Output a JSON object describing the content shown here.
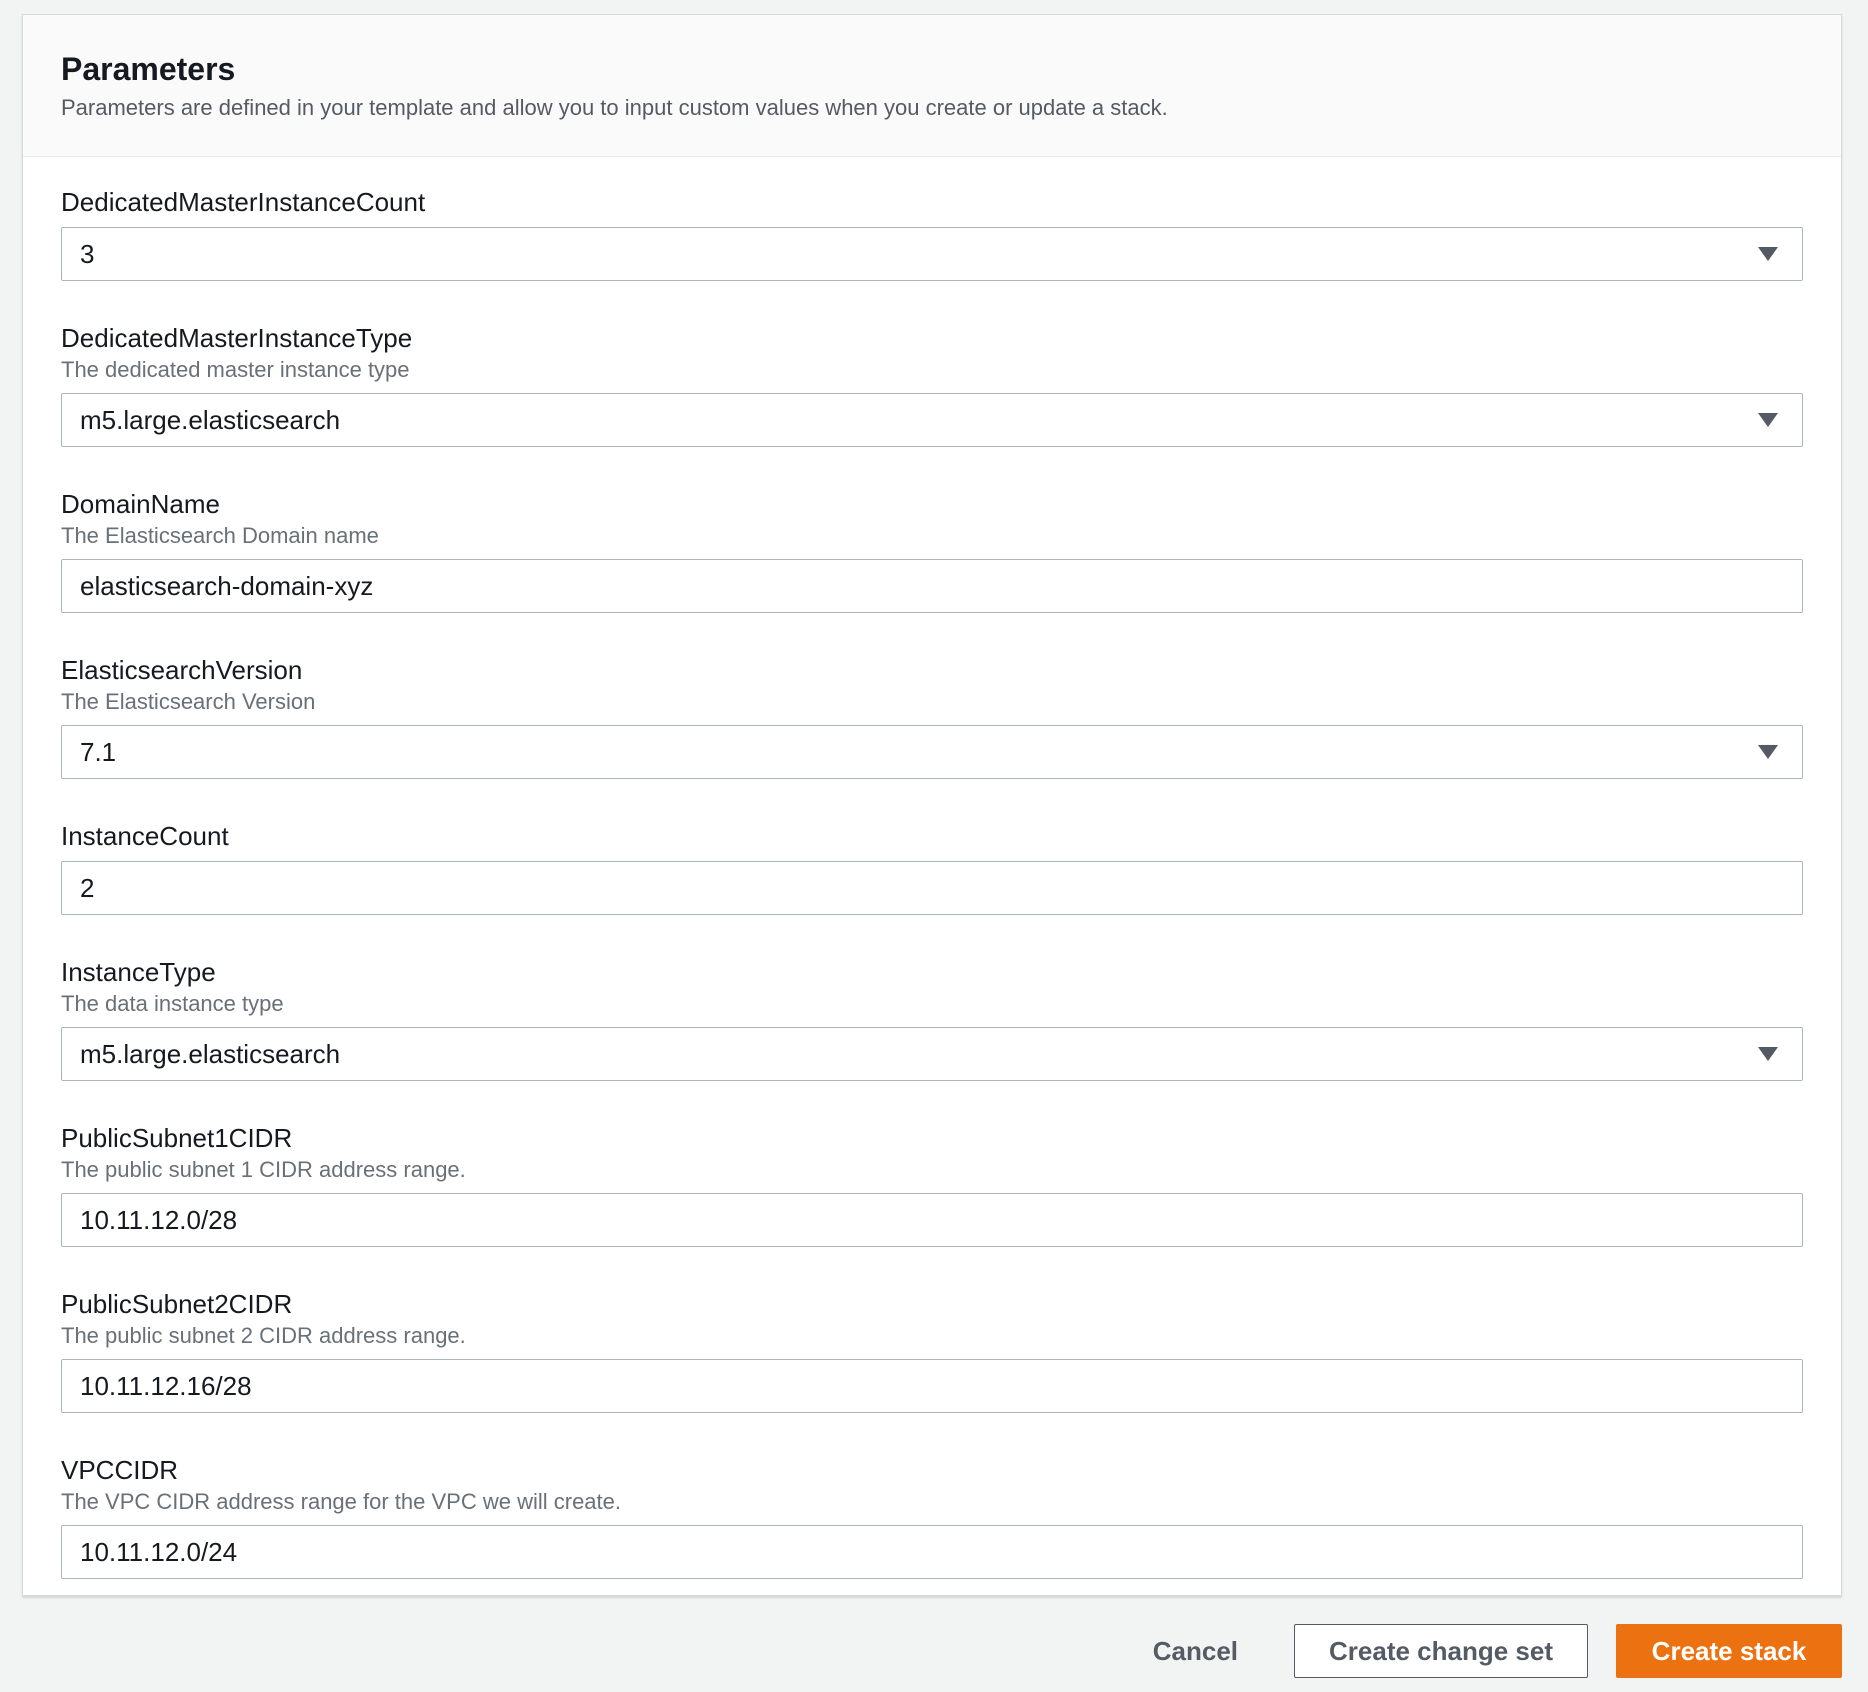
{
  "panel": {
    "title": "Parameters",
    "description": "Parameters are defined in your template and allow you to input custom values when you create or update a stack."
  },
  "params": [
    {
      "label": "DedicatedMasterInstanceCount",
      "help": "",
      "value": "3",
      "type": "select"
    },
    {
      "label": "DedicatedMasterInstanceType",
      "help": "The dedicated master instance type",
      "value": "m5.large.elasticsearch",
      "type": "select"
    },
    {
      "label": "DomainName",
      "help": "The Elasticsearch Domain name",
      "value": "elasticsearch-domain-xyz",
      "type": "input"
    },
    {
      "label": "ElasticsearchVersion",
      "help": "The Elasticsearch Version",
      "value": "7.1",
      "type": "select"
    },
    {
      "label": "InstanceCount",
      "help": "",
      "value": "2",
      "type": "input"
    },
    {
      "label": "InstanceType",
      "help": "The data instance type",
      "value": "m5.large.elasticsearch",
      "type": "select"
    },
    {
      "label": "PublicSubnet1CIDR",
      "help": "The public subnet 1 CIDR address range.",
      "value": "10.11.12.0/28",
      "type": "input"
    },
    {
      "label": "PublicSubnet2CIDR",
      "help": "The public subnet 2 CIDR address range.",
      "value": "10.11.12.16/28",
      "type": "input"
    },
    {
      "label": "VPCCIDR",
      "help": "The VPC CIDR address range for the VPC we will create.",
      "value": "10.11.12.0/24",
      "type": "input"
    }
  ],
  "footer": {
    "cancel_label": "Cancel",
    "change_set_label": "Create change set",
    "create_label": "Create stack"
  },
  "colors": {
    "primary": "#ec7211",
    "page_bg": "#f2f3f3",
    "border": "#aab7b8"
  },
  "icons": {
    "dropdown": "caret-down-icon"
  }
}
